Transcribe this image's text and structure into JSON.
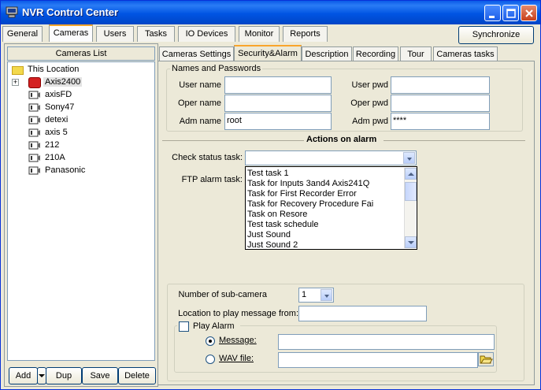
{
  "window": {
    "title": "NVR Control Center"
  },
  "main_tabs": [
    "General",
    "Cameras",
    "Users",
    "Tasks",
    "IO Devices",
    "Monitor",
    "Reports"
  ],
  "sync_label": "Synchronize",
  "left": {
    "header": "Cameras List",
    "tree": [
      "This Location",
      "Axis2400",
      "axisFD",
      "Sony47",
      "detexi",
      "axis 5",
      "212",
      "210A",
      "Panasonic"
    ],
    "buttons": {
      "add": "Add",
      "dup": "Dup",
      "save": "Save",
      "delete": "Delete"
    }
  },
  "sub_tabs": [
    "Cameras Settings",
    "Security&Alarm",
    "Description",
    "Recording",
    "Tour",
    "Cameras tasks"
  ],
  "names": {
    "group_title": "Names and Passwords",
    "user_name_label": "User name",
    "oper_name_label": "Oper name",
    "adm_name_label": "Adm name",
    "user_name": "",
    "oper_name": "",
    "adm_name": "root",
    "user_pwd_label": "User pwd",
    "oper_pwd_label": "Oper pwd",
    "adm_pwd_label": "Adm pwd",
    "user_pwd": "",
    "oper_pwd": "",
    "adm_pwd": "****"
  },
  "alarm": {
    "title": "Actions on alarm",
    "check_status_label": "Check status task:",
    "ftp_alarm_label": "FTP alarm task:",
    "check_status_value": "",
    "options": [
      "Test task 1",
      "Task for Inputs 3and4 Axis241Q",
      "Task for First Recorder Error",
      "Task for Recovery Procedure Fai",
      "Task on Resore",
      "Test task schedule",
      "Just Sound",
      "Just Sound 2"
    ]
  },
  "bottom": {
    "subcam_label": "Number of sub-camera",
    "subcam_value": "1",
    "location_label": "Location to play message from:",
    "location_value": "",
    "play_alarm_label": "Play Alarm",
    "message_label": "Message:",
    "message_value": "",
    "wav_label": "WAV file:",
    "wav_value": ""
  }
}
